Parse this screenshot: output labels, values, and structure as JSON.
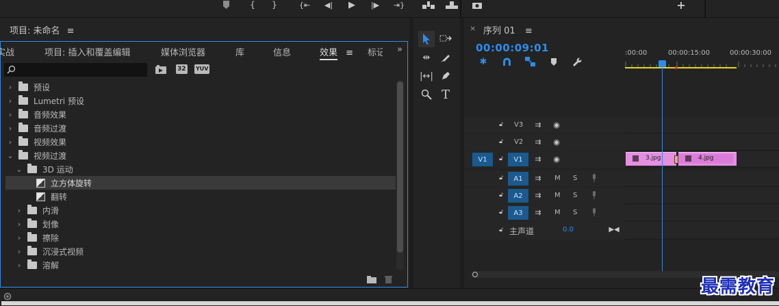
{
  "transport": {
    "icons": [
      "marker-icon",
      "mark-in-icon",
      "mark-out-icon",
      "go-to-in-icon",
      "step-back-icon",
      "play-icon",
      "step-forward-icon",
      "go-to-out-icon",
      "insert-icon",
      "overwrite-icon",
      "export-frame-icon",
      "add-icon"
    ]
  },
  "project": {
    "title": "项目: 未命名",
    "tabs": [
      "实战",
      "项目: 插入和覆盖编辑",
      "媒体浏览器",
      "库",
      "信息",
      "效果",
      "标记"
    ],
    "active_tab": "效果",
    "search_placeholder": "",
    "badges": [
      "32",
      "YUV"
    ],
    "tree": [
      {
        "label": "预设",
        "indent": 0,
        "chevron": "›",
        "kind": "folder-star"
      },
      {
        "label": "Lumetri 预设",
        "indent": 0,
        "chevron": "›",
        "kind": "folder-star"
      },
      {
        "label": "音频效果",
        "indent": 0,
        "chevron": "›",
        "kind": "folder"
      },
      {
        "label": "音频过渡",
        "indent": 0,
        "chevron": "›",
        "kind": "folder"
      },
      {
        "label": "视频效果",
        "indent": 0,
        "chevron": "›",
        "kind": "folder"
      },
      {
        "label": "视频过渡",
        "indent": 0,
        "chevron": "⌄",
        "kind": "folder"
      },
      {
        "label": "3D 运动",
        "indent": 1,
        "chevron": "⌄",
        "kind": "folder"
      },
      {
        "label": "立方体旋转",
        "indent": 2,
        "chevron": "",
        "kind": "fx",
        "selected": true
      },
      {
        "label": "翻转",
        "indent": 2,
        "chevron": "",
        "kind": "fx"
      },
      {
        "label": "内滑",
        "indent": 1,
        "chevron": "›",
        "kind": "folder"
      },
      {
        "label": "划像",
        "indent": 1,
        "chevron": "›",
        "kind": "folder"
      },
      {
        "label": "擦除",
        "indent": 1,
        "chevron": "›",
        "kind": "folder"
      },
      {
        "label": "沉浸式视频",
        "indent": 1,
        "chevron": "›",
        "kind": "folder"
      },
      {
        "label": "溶解",
        "indent": 1,
        "chevron": "›",
        "kind": "folder"
      }
    ]
  },
  "tools": {
    "items": [
      "selection-tool",
      "track-select-tool",
      "ripple-edit-tool",
      "razor-tool",
      "slip-tool",
      "pen-tool",
      "zoom-tool",
      "type-tool"
    ]
  },
  "timeline": {
    "tab_close": "×",
    "sequence_title": "序列 01",
    "timecode": "00:00:09:01",
    "ruler_labels": [
      ":00:00",
      "00:00:15:00",
      "00:00:30:00"
    ],
    "tracks": [
      {
        "name": "V3",
        "type": "video",
        "target": false
      },
      {
        "name": "V2",
        "type": "video",
        "target": false
      },
      {
        "name": "V1",
        "type": "video",
        "target": true,
        "source": "V1"
      },
      {
        "name": "A1",
        "type": "audio",
        "target": true,
        "m": "M",
        "s": "S"
      },
      {
        "name": "A2",
        "type": "audio",
        "target": true,
        "m": "M",
        "s": "S"
      },
      {
        "name": "A3",
        "type": "audio",
        "target": true,
        "m": "M",
        "s": "S"
      }
    ],
    "master": {
      "label": "主声道",
      "value": "0.0"
    },
    "clips": [
      {
        "label": "3.jpg",
        "track": "V1"
      },
      {
        "label": "4.jpg",
        "track": "V1"
      }
    ]
  },
  "watermark": "最需教育",
  "colors": {
    "accent": "#2d8ceb",
    "clip": "#e58fe1",
    "track_target": "#1a5a8f"
  }
}
